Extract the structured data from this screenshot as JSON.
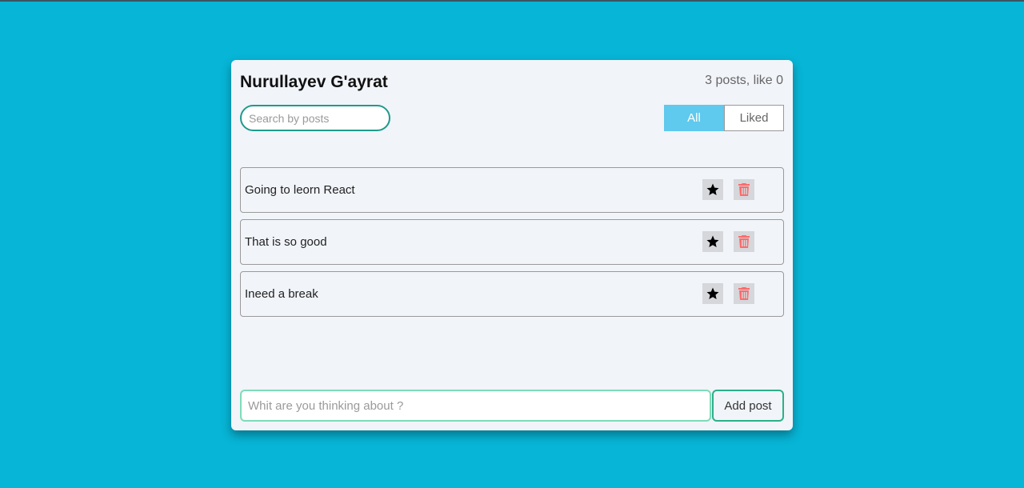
{
  "header": {
    "title": "Nurullayev G'ayrat",
    "stats": "3 posts, like 0"
  },
  "search": {
    "placeholder": "Search by posts",
    "value": ""
  },
  "filters": {
    "all_label": "All",
    "liked_label": "Liked",
    "active": "All"
  },
  "posts": [
    {
      "text": "Going to leorn React"
    },
    {
      "text": "That is so good"
    },
    {
      "text": "Ineed a break"
    }
  ],
  "add_form": {
    "placeholder": "Whit are you thinking about ?",
    "value": "",
    "button_label": "Add post"
  },
  "icons": {
    "favorite": "star-icon",
    "delete": "trash-icon"
  },
  "colors": {
    "background": "#07b5d6",
    "card": "#f1f4f9",
    "accent_active": "#5fc9ee",
    "search_border": "#1e9a8c",
    "input_border": "#7ddcb8",
    "delete_icon": "#ff6b6b"
  }
}
